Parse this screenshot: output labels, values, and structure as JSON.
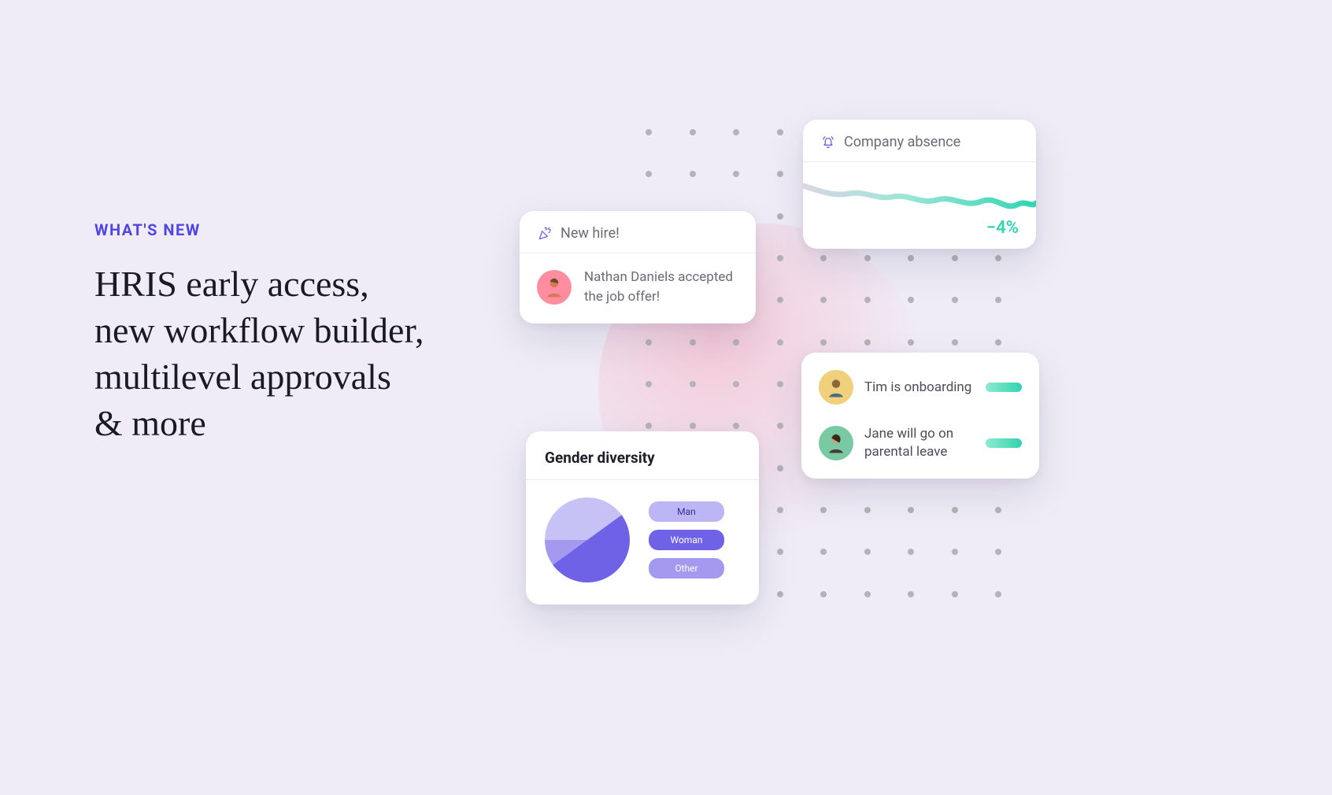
{
  "hero": {
    "eyebrow": "WHAT'S NEW",
    "headline_l1": "HRIS early access,",
    "headline_l2": "new workflow builder,",
    "headline_l3": "multilevel approvals",
    "headline_l4": "& more"
  },
  "new_hire": {
    "title": "New hire!",
    "message": "Nathan Daniels accepted the job offer!"
  },
  "absence": {
    "title": "Company absence",
    "delta": "−4%"
  },
  "status": {
    "items": [
      {
        "text": "Tim is onboarding"
      },
      {
        "text": "Jane will go on parental leave"
      }
    ]
  },
  "gender": {
    "title": "Gender diversity",
    "legend": [
      "Man",
      "Woman",
      "Other"
    ]
  },
  "chart_data": [
    {
      "type": "line",
      "title": "Company absence",
      "series": [
        {
          "name": "absence",
          "values": [
            72,
            66,
            58,
            62,
            56,
            48,
            52,
            46,
            54,
            44,
            50,
            38,
            46,
            42
          ]
        }
      ],
      "x": [
        0,
        1,
        2,
        3,
        4,
        5,
        6,
        7,
        8,
        9,
        10,
        11,
        12,
        13
      ],
      "ylim": [
        0,
        100
      ],
      "delta_label": "−4%"
    },
    {
      "type": "pie",
      "title": "Gender diversity",
      "categories": [
        "Man",
        "Woman",
        "Other"
      ],
      "values": [
        40,
        50,
        10
      ]
    }
  ]
}
